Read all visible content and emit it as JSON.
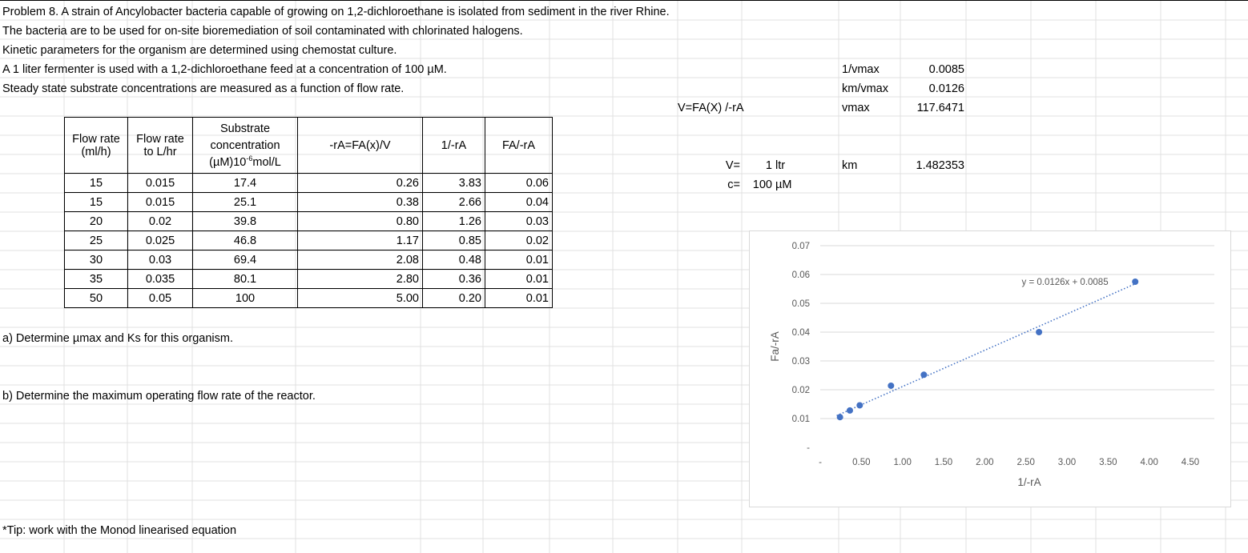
{
  "problem": {
    "lines": [
      "Problem 8. A strain of Ancylobacter bacteria capable of growing on 1,2-dichloroethane is isolated from sediment in the river Rhine.",
      "The bacteria are to be used for on-site bioremediation of soil contaminated with chlorinated halogens.",
      "Kinetic parameters for the organism are determined using chemostat culture.",
      "A 1 liter fermenter is used with a 1,2-dichloroethane feed at a concentration of 100 µM.",
      "Steady state substrate concentrations are measured as a function of flow rate."
    ],
    "question_a": "a) Determine µmax and Ks for this organism.",
    "question_b": "b) Determine the maximum operating flow rate of the reactor.",
    "tip": "*Tip: work with the Monod linearised equation"
  },
  "table": {
    "headers": {
      "flow_ml_1": "Flow rate",
      "flow_ml_2": "(ml/h)",
      "flow_l_1": "Flow rate",
      "flow_l_2": "to L/hr",
      "sub_1": "Substrate",
      "sub_2": "concentration",
      "sub_3_pre": "(µM)10",
      "sub_3_sup": "-6",
      "sub_3_post": "mol/L",
      "ra": "-rA=FA(x)/V",
      "inv_ra": "1/-rA",
      "fa_ra": "FA/-rA"
    },
    "rows": [
      [
        "15",
        "0.015",
        "17.4",
        "0.26",
        "3.83",
        "0.06"
      ],
      [
        "15",
        "0.015",
        "25.1",
        "0.38",
        "2.66",
        "0.04"
      ],
      [
        "20",
        "0.02",
        "39.8",
        "0.80",
        "1.26",
        "0.03"
      ],
      [
        "25",
        "0.025",
        "46.8",
        "1.17",
        "0.85",
        "0.02"
      ],
      [
        "30",
        "0.03",
        "69.4",
        "2.08",
        "0.48",
        "0.01"
      ],
      [
        "35",
        "0.035",
        "80.1",
        "2.80",
        "0.36",
        "0.01"
      ],
      [
        "50",
        "0.05",
        "100",
        "5.00",
        "0.20",
        "0.01"
      ]
    ]
  },
  "side": {
    "formula": "V=FA(X) /-rA",
    "v_label": "V=",
    "v_value": "1",
    "v_unit": "ltr",
    "c_label": "c=",
    "c_value": "100",
    "c_unit": "µM",
    "inv_vmax_label": "1/vmax",
    "inv_vmax_value": "0.0085",
    "km_vmax_label": "km/vmax",
    "km_vmax_value": "0.0126",
    "vmax_label": "vmax",
    "vmax_value": "117.6471",
    "km_label": "km",
    "km_value": "1.482353"
  },
  "chart_data": {
    "type": "scatter",
    "xlabel": "1/-rA",
    "ylabel": "Fa/-rA",
    "x_ticks": [
      "-",
      "0.50",
      "1.00",
      "1.50",
      "2.00",
      "2.50",
      "3.00",
      "3.50",
      "4.00",
      "4.50"
    ],
    "x_tick_values": [
      0,
      0.5,
      1.0,
      1.5,
      2.0,
      2.5,
      3.0,
      3.5,
      4.0,
      4.5
    ],
    "y_ticks": [
      "-",
      "0.01",
      "0.02",
      "0.03",
      "0.04",
      "0.05",
      "0.06",
      "0.07"
    ],
    "y_tick_values": [
      0,
      0.01,
      0.02,
      0.03,
      0.04,
      0.05,
      0.06,
      0.07
    ],
    "xlim": [
      0,
      4.5
    ],
    "ylim": [
      0,
      0.07
    ],
    "points": [
      {
        "x": 0.24,
        "y": 0.0105
      },
      {
        "x": 0.36,
        "y": 0.0128
      },
      {
        "x": 0.48,
        "y": 0.0146
      },
      {
        "x": 0.86,
        "y": 0.0214
      },
      {
        "x": 1.26,
        "y": 0.0252
      },
      {
        "x": 2.66,
        "y": 0.04
      },
      {
        "x": 3.83,
        "y": 0.0575
      }
    ],
    "trendline": {
      "slope": 0.0126,
      "intercept": 0.0085,
      "x_start": 0.2,
      "x_end": 3.83
    },
    "equation": "y = 0.0126x + 0.0085",
    "grid": true,
    "colors": {
      "points": "#4472c4",
      "trend": "#4472c4",
      "grid": "#d9d9d9"
    }
  }
}
